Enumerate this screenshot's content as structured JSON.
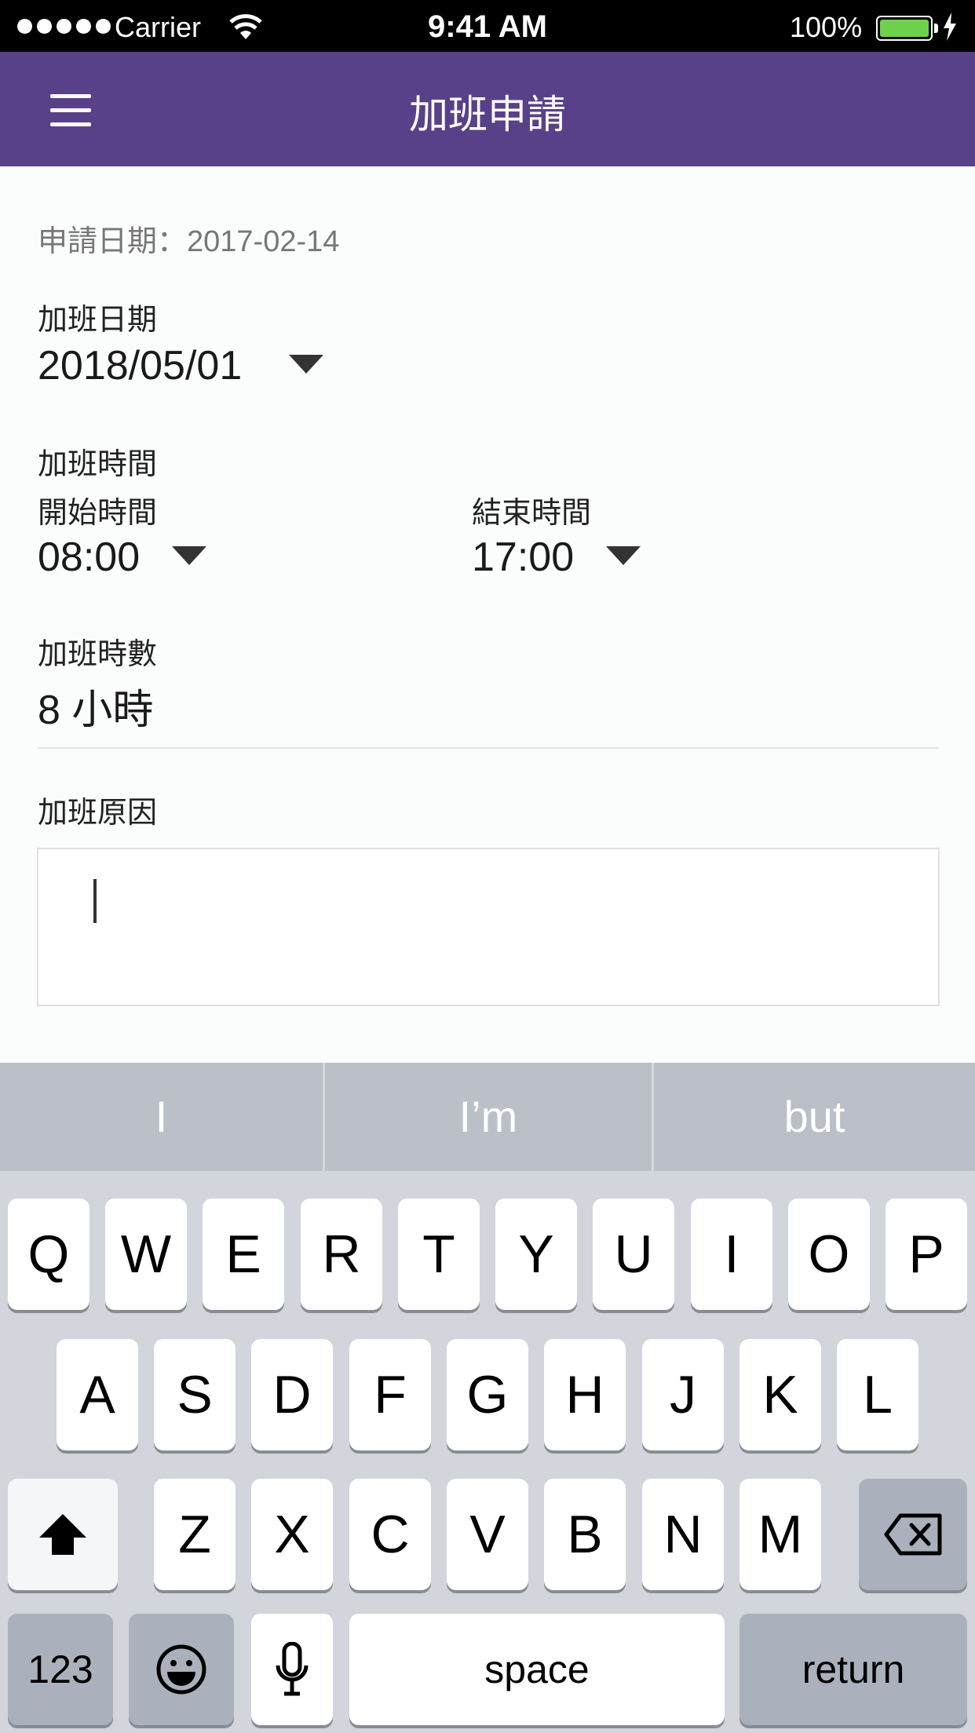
{
  "status_bar": {
    "carrier": "Carrier",
    "time": "9:41 AM",
    "battery": "100%",
    "signal_icon": "signal-dots-icon",
    "wifi_icon": "wifi-icon",
    "battery_icon": "battery-icon",
    "charging_icon": "charging-bolt-icon",
    "battery_color": "#6fd14b"
  },
  "nav": {
    "title": "加班申請",
    "menu_icon": "hamburger-menu-icon",
    "background": "#584189"
  },
  "form": {
    "apply_date": "申請日期：2017-02-14",
    "ot_date_label": "加班日期",
    "ot_date_value": "2018/05/01",
    "ot_time_label": "加班時間",
    "start_label": "開始時間",
    "start_value": "08:00",
    "end_label": "結束時間",
    "end_value": "17:00",
    "hours_label": "加班時數",
    "hours_value": "8 小時",
    "reason_label": "加班原因",
    "reason_value": ""
  },
  "keyboard": {
    "suggestions": [
      "I",
      "I’m",
      "but"
    ],
    "row1": [
      "Q",
      "W",
      "E",
      "R",
      "T",
      "Y",
      "U",
      "I",
      "O",
      "P"
    ],
    "row2": [
      "A",
      "S",
      "D",
      "F",
      "G",
      "H",
      "J",
      "K",
      "L"
    ],
    "row3": [
      "Z",
      "X",
      "C",
      "V",
      "B",
      "N",
      "M"
    ],
    "numbers_label": "123",
    "space_label": "space",
    "return_label": "return",
    "shift_icon": "shift-icon",
    "delete_icon": "backspace-icon",
    "emoji_icon": "emoji-icon",
    "mic_icon": "microphone-icon"
  }
}
